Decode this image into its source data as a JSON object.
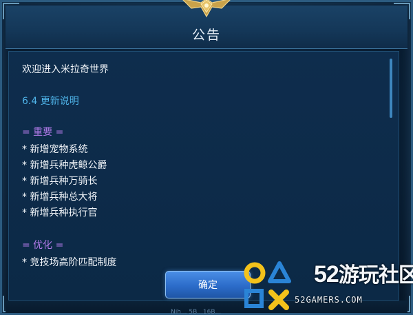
{
  "dialog": {
    "title": "公告",
    "confirm_label": "确定",
    "bottom_text": "Nih... 5B...16B..."
  },
  "content": {
    "welcome": "欢迎进入米拉奇世界",
    "version_heading": "6.4 更新说明",
    "section_important": "= 重要 =",
    "important_items": [
      "* 新增宠物系统",
      "* 新增兵种虎鲸公爵",
      "* 新增兵种万骑长",
      "* 新增兵种总大将",
      "* 新增兵种执行官"
    ],
    "section_optimize": "= 优化 =",
    "optimize_items": [
      "* 竞技场高阶匹配制度"
    ]
  },
  "watermark": {
    "number": "52",
    "name": "游玩社区",
    "url": "52GAMERS.COM"
  },
  "colors": {
    "heading_blue": "#4fb3e8",
    "section_purple": "#b07ae8",
    "button_blue": "#2c6cc9"
  }
}
